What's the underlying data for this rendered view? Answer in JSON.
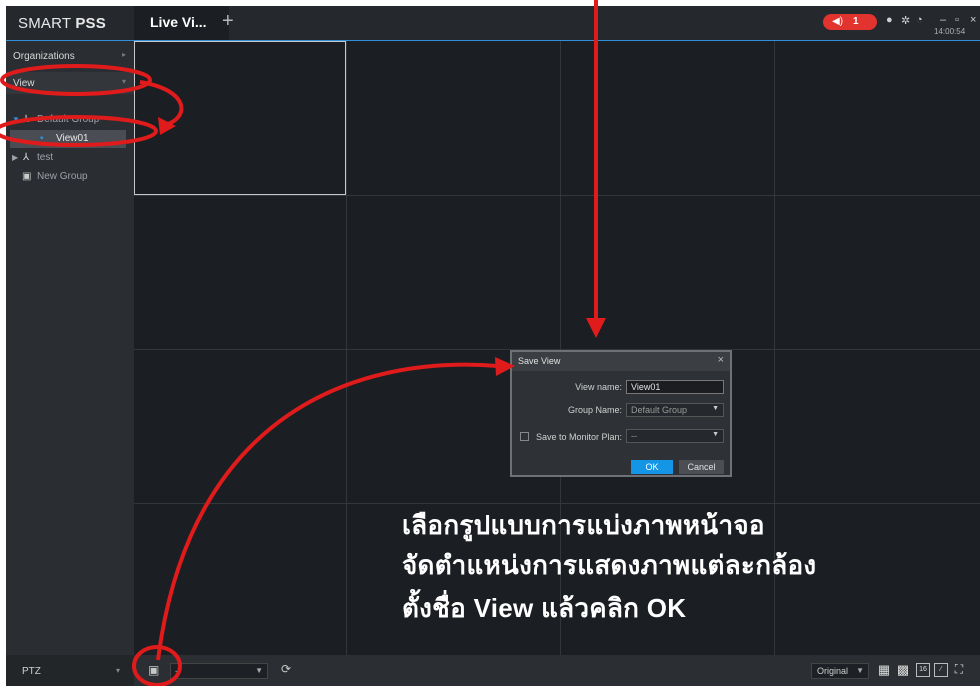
{
  "app": {
    "brand_light": "SMART ",
    "brand_bold": "PSS",
    "tab_label": "Live Vi...",
    "tab_add": "+",
    "alarm_count": "1",
    "clock": "14:00:54",
    "window_controls": [
      "–",
      "▫",
      "×"
    ]
  },
  "sidebar": {
    "organizations": "Organizations",
    "view": "View",
    "tree": {
      "default_group": "Default Group",
      "view01": "View01",
      "test": "test",
      "new_group": "New Group"
    },
    "ptz": "PTZ"
  },
  "bottom": {
    "stream_value": "--",
    "zoom_select": "Original",
    "layout_16": "16"
  },
  "dialog": {
    "title": "Save View",
    "view_name_label": "View name:",
    "view_name_value": "View01",
    "group_name_label": "Group Name:",
    "group_name_value": "Default Group",
    "monitor_plan_label": "Save to Monitor Plan:",
    "monitor_plan_value": "--",
    "ok": "OK",
    "cancel": "Cancel"
  },
  "annotation": {
    "line1": "เลือกรูปแบบการแบ่งภาพหน้าจอ",
    "line2": "จัดตำแหน่งการแสดงภาพแต่ละกล้อง",
    "line3": "ตั้งชื่อ View แล้วคลิก OK"
  },
  "colors": {
    "accent": "#1495e6",
    "annotation_red": "#e01b1b",
    "alarm_red": "#e2332f",
    "background": "#1b1e22"
  }
}
